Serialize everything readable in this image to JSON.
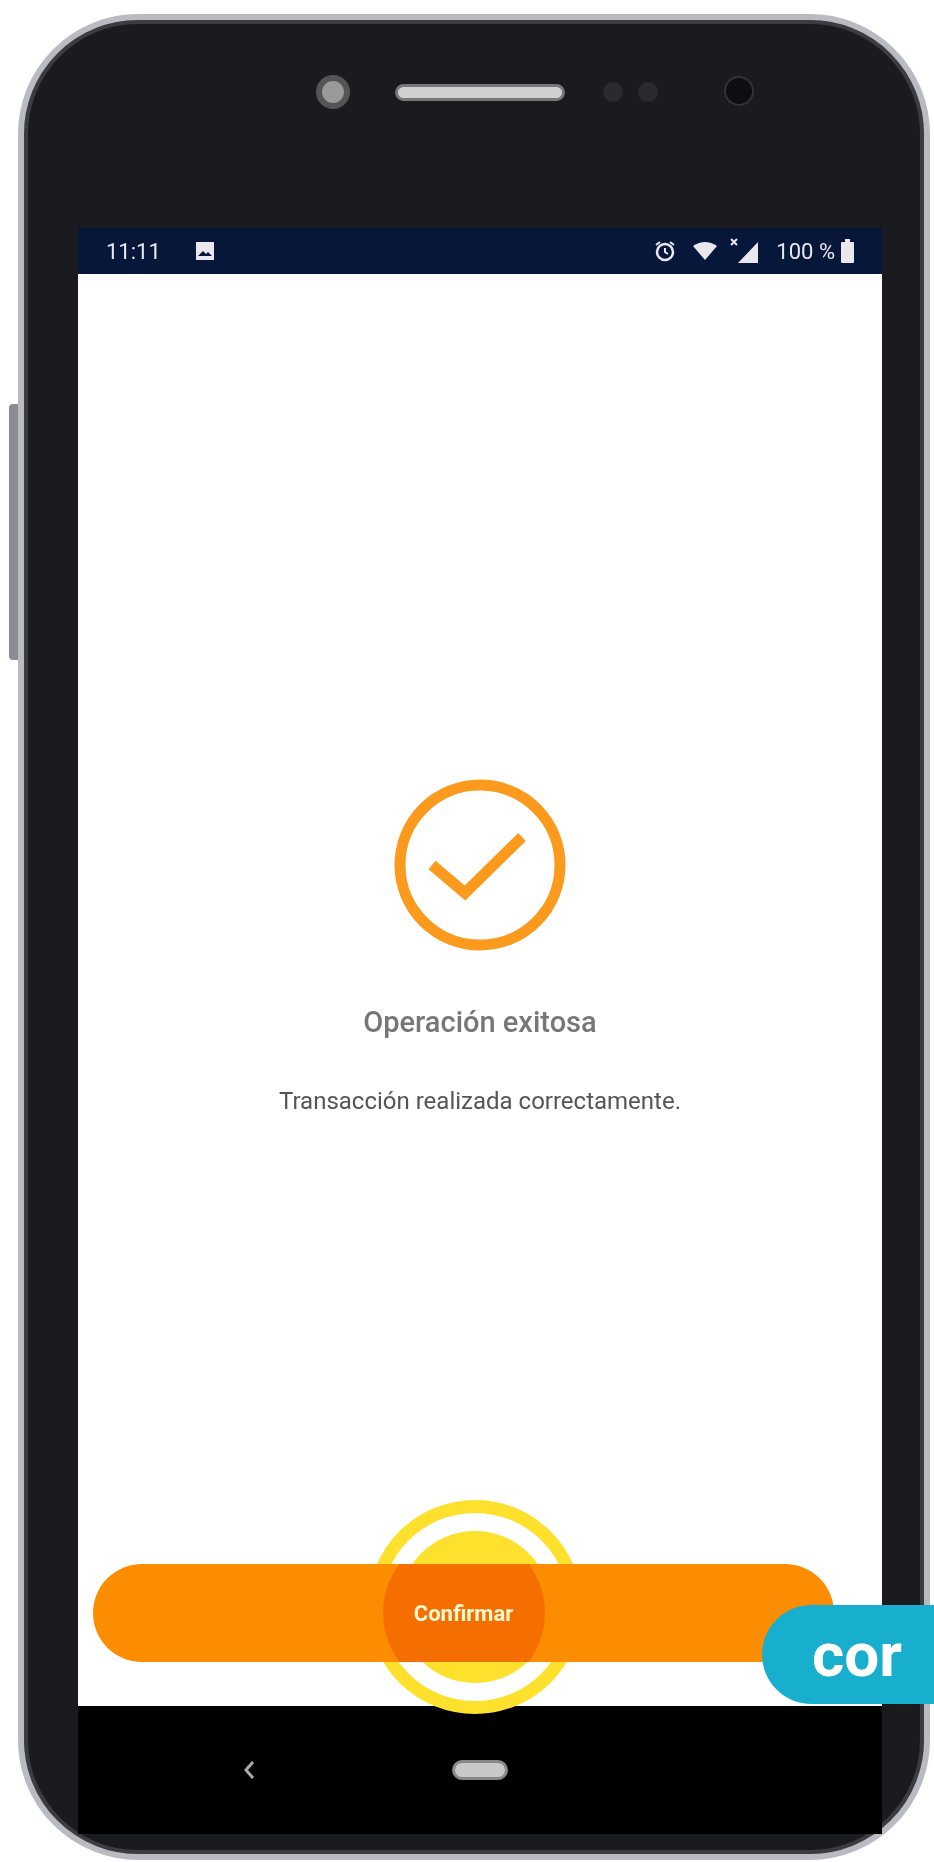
{
  "status_bar": {
    "time": "11:11",
    "battery": "100 %"
  },
  "result": {
    "title": "Operación exitosa",
    "message": "Transacción realizada correctamente."
  },
  "button": {
    "label": "Confirmar"
  },
  "tutorial_badge": {
    "text": "cor"
  }
}
